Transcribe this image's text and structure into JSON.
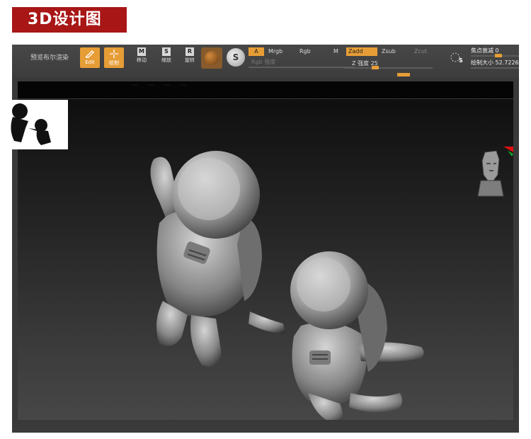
{
  "banner": {
    "title": "3D设计图"
  },
  "toolbar": {
    "preview_label": "预览布尔渲染",
    "edit_label": "Edit",
    "draw_label": "绘制",
    "move_label": "移动",
    "scale_label": "缩放",
    "rotate_label": "旋转",
    "move_glyph": "M",
    "scale_glyph": "S",
    "rotate_glyph": "R",
    "mat_glyph": "S",
    "mode_a": "A",
    "mode_mrgb": "Mrgb",
    "mode_rgb": "Rgb",
    "mode_m": "M",
    "mode_zadd": "Zadd",
    "mode_zsub": "Zsub",
    "mode_zcut": "Zcut",
    "rgb_intensity_label": "Rgb 强度",
    "z_intensity_label": "Z 强度 25",
    "focal_shift_label": "焦点衰减 0",
    "draw_size_label": "绘制大小 52.7226",
    "brush_glyph": "S"
  },
  "accent_color": "#e79d36",
  "banner_color": "#a81616"
}
